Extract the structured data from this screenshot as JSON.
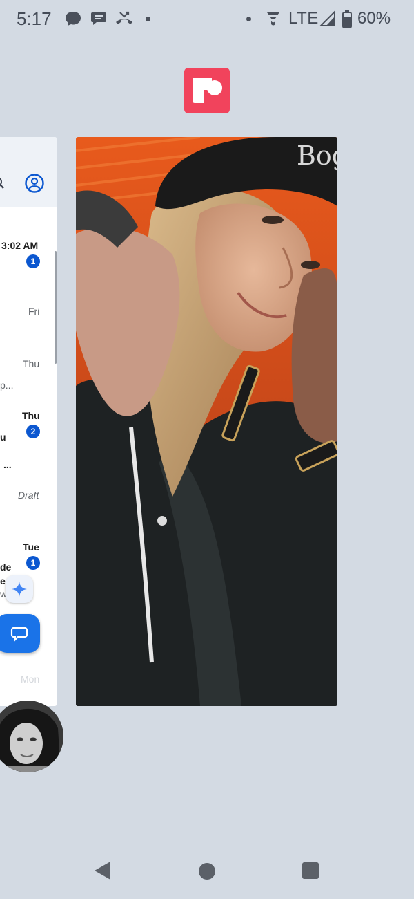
{
  "status_bar": {
    "time": "5:17",
    "network": "LTE",
    "battery": "60%",
    "icons": [
      "chat-icon",
      "messages-icon",
      "missed-call-icon",
      "notification-dot",
      "notification-dot",
      "wifi-calling-icon",
      "signal-icon",
      "battery-icon"
    ]
  },
  "recents": {
    "app_icon": "app-logo-icon",
    "left_card": {
      "header_icons": [
        "search-icon",
        "account-icon"
      ],
      "emails": [
        {
          "date": "3:02 AM",
          "date_bold": true,
          "badge": "1",
          "snippet": ""
        },
        {
          "date": "Fri",
          "date_bold": false,
          "badge": "",
          "snippet": ""
        },
        {
          "date": "Thu",
          "date_bold": false,
          "badge": "",
          "snippet": "p..."
        },
        {
          "date": "Thu",
          "date_bold": true,
          "badge": "2",
          "snippet": "u",
          "snippet2": "..."
        },
        {
          "date": "Draft",
          "date_bold": false,
          "badge": "",
          "snippet": ""
        },
        {
          "date": "Tue",
          "date_bold": true,
          "badge": "1",
          "snippet": "de",
          "snippet2": "e",
          "snippet3": "w."
        },
        {
          "date": "Mon",
          "date_bold": false,
          "badge": "",
          "snippet": ""
        }
      ],
      "buttons": [
        "sparkle-icon",
        "compose-icon"
      ]
    },
    "photo_card": {
      "hat_text": "Bog"
    },
    "bubble": "avatar"
  },
  "nav_bar": [
    "back-button",
    "home-button",
    "recents-button"
  ],
  "colors": {
    "background": "#d3dae3",
    "accent": "#0b57d0",
    "app_icon": "#f1435c"
  }
}
